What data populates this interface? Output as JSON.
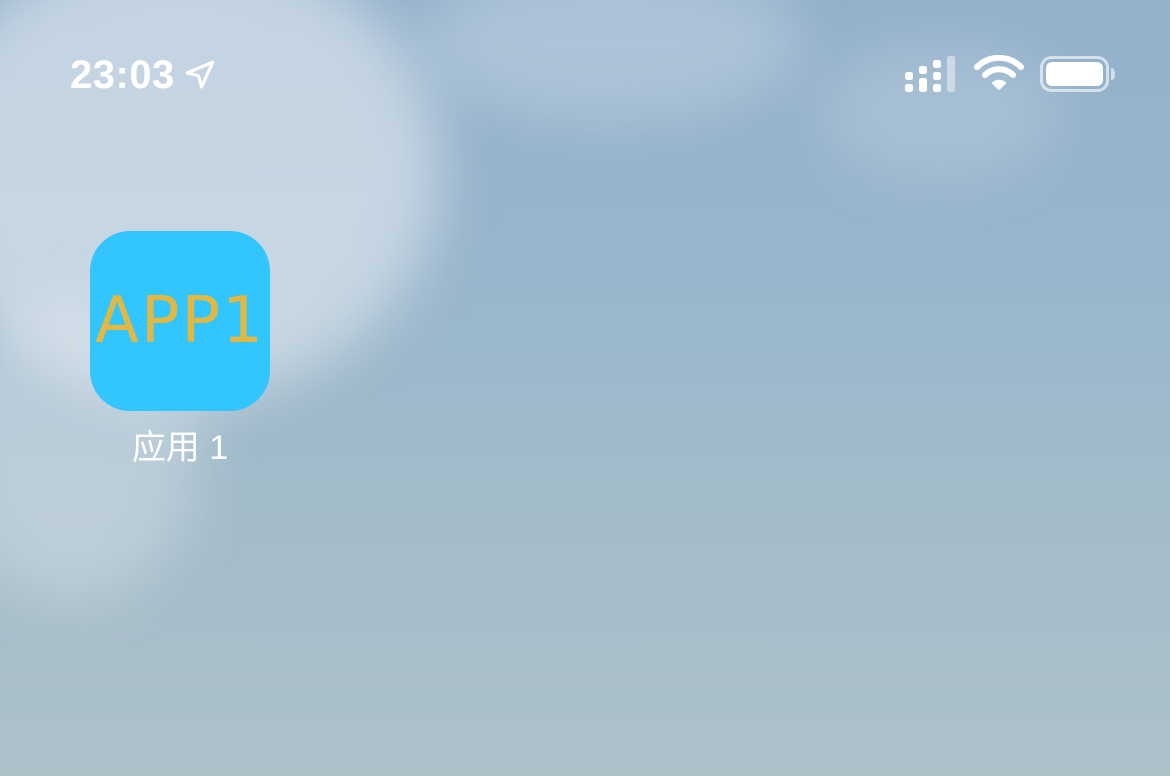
{
  "status_bar": {
    "time": "23:03",
    "icons": [
      "location-arrow-icon",
      "cellular-signal-icon",
      "wifi-icon",
      "battery-icon"
    ]
  },
  "home_screen": {
    "apps": [
      {
        "label": "应用 1",
        "icon_text": "APP1",
        "icon_background": "#33c5fe",
        "icon_text_color": "#e2b843"
      }
    ]
  },
  "colors": {
    "wallpaper_sky": "#9ab5cb",
    "status_text": "#ffffff"
  }
}
